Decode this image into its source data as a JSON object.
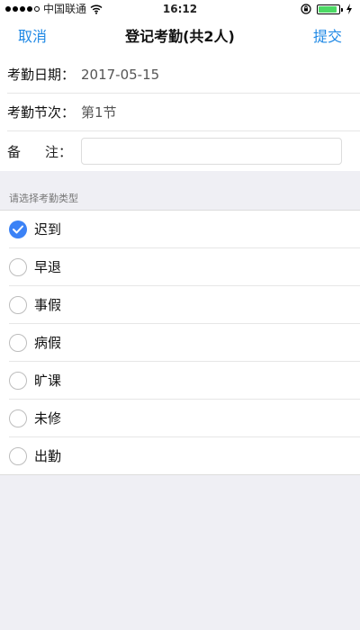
{
  "status_bar": {
    "carrier": "中国联通",
    "time": "16:12",
    "battery_level_fraction": 0.92
  },
  "nav": {
    "cancel_label": "取消",
    "title": "登记考勤(共2人)",
    "submit_label": "提交"
  },
  "form": {
    "date_label": "考勤日期：",
    "date_value": "2017-05-15",
    "session_label": "考勤节次：",
    "session_value": "第1节",
    "remark_label_left": "备",
    "remark_label_right": "注：",
    "remark_value": "",
    "remark_placeholder": ""
  },
  "section_header": "请选择考勤类型",
  "attendance_types": [
    {
      "label": "迟到",
      "checked": true
    },
    {
      "label": "早退",
      "checked": false
    },
    {
      "label": "事假",
      "checked": false
    },
    {
      "label": "病假",
      "checked": false
    },
    {
      "label": "旷课",
      "checked": false
    },
    {
      "label": "未修",
      "checked": false
    },
    {
      "label": "出勤",
      "checked": false
    }
  ],
  "colors": {
    "accent": "#1e88e5",
    "checked": "#3b82f6",
    "background": "#efeff4",
    "battery": "#4cd964"
  },
  "icons": {
    "wifi": "wifi-icon",
    "rotation_lock": "rotation-lock-icon",
    "battery": "battery-icon",
    "charging": "charging-icon",
    "check": "checkmark-icon"
  }
}
